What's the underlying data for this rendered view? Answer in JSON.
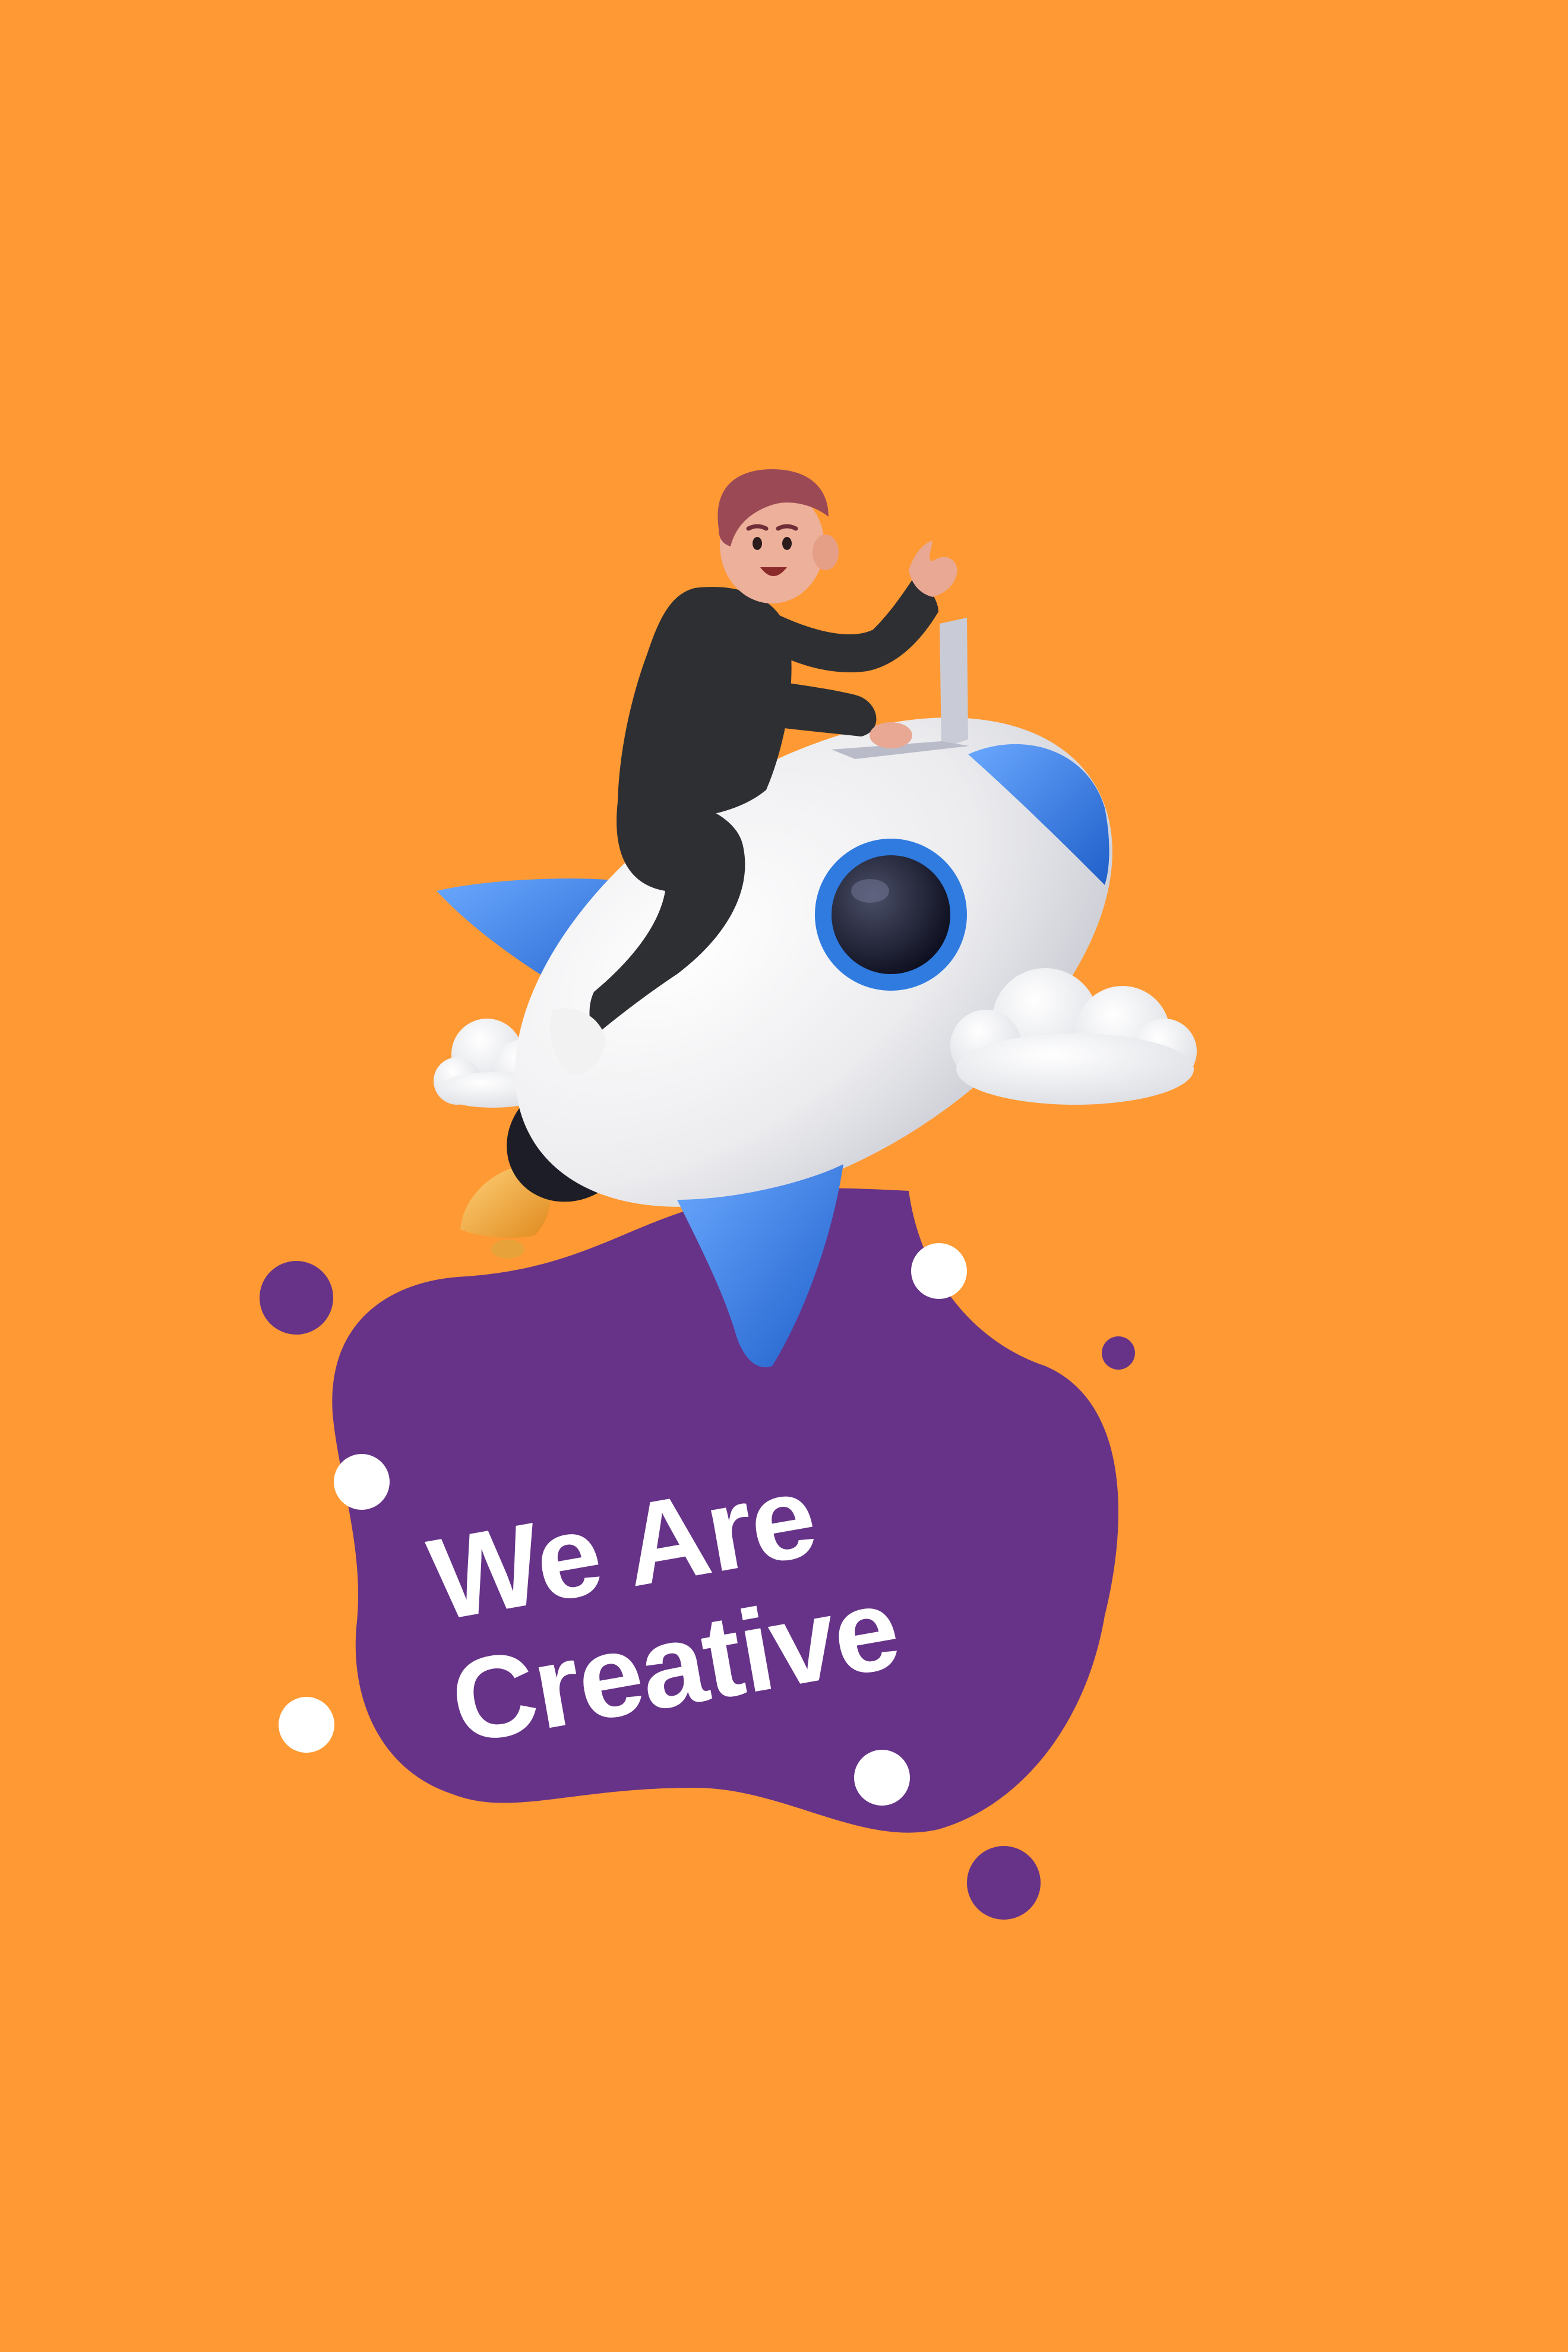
{
  "poster": {
    "headline_line1": "We Are",
    "headline_line2": "Creative"
  },
  "colors": {
    "background": "#FF9933",
    "blob": "#663388",
    "headline_text": "#FFFFFF",
    "rocket_body": "#F2F2F4",
    "rocket_accent": "#2F7BE0",
    "character_outfit": "#2E2F33",
    "character_hair": "#9B4A55",
    "cloud": "#FAFAFA",
    "flame": "#F2A23A"
  }
}
